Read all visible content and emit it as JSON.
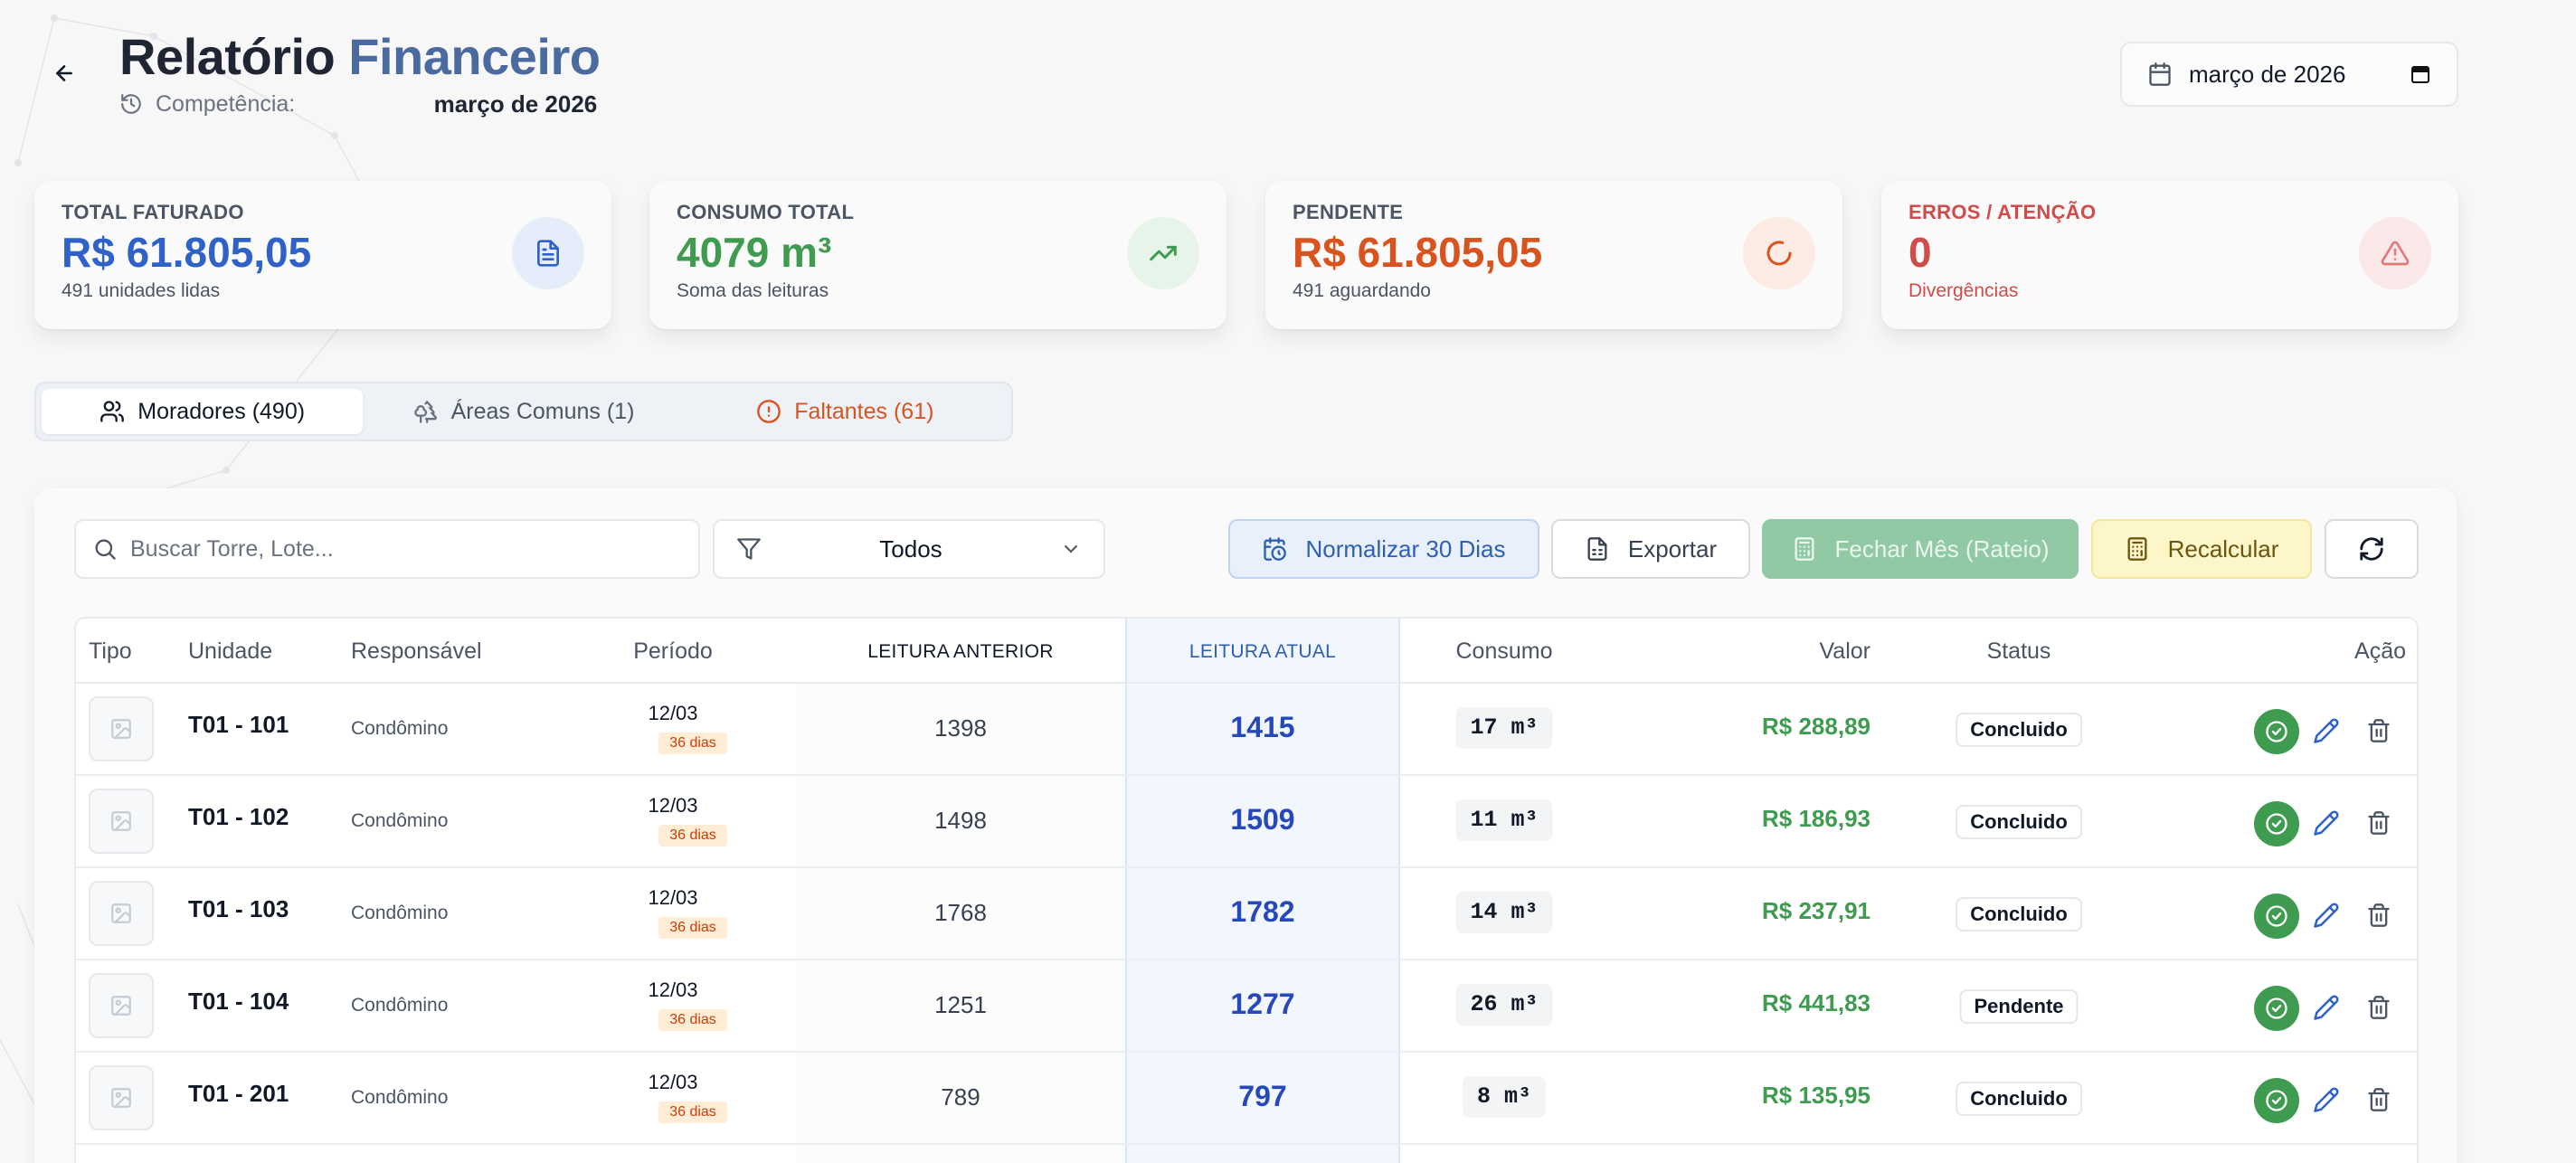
{
  "header": {
    "title_main": "Relatório",
    "title_accent": "Financeiro",
    "competencia_label": "Competência:",
    "competencia_value": "março de 2026",
    "month_picker_value": "março de 2026"
  },
  "stats": [
    {
      "label": "TOTAL FATURADO",
      "value": "R$ 61.805,05",
      "sub": "491 unidades lidas",
      "color": "#2f62c9",
      "icon": "document-icon"
    },
    {
      "label": "CONSUMO TOTAL",
      "value": "4079 m³",
      "sub": "Soma das leituras",
      "color": "#3f9b50",
      "icon": "trending-up-icon"
    },
    {
      "label": "PENDENTE",
      "value": "R$ 61.805,05",
      "sub": "491 aguardando",
      "color": "#d9531e",
      "icon": "spinner-icon"
    },
    {
      "label": "ERROS / ATENÇÃO",
      "value": "0",
      "sub": "Divergências",
      "color": "#d14b4b",
      "icon": "warning-icon"
    }
  ],
  "tabs": [
    {
      "label": "Moradores (490)",
      "icon": "users-icon",
      "active": true
    },
    {
      "label": "Áreas Comuns (1)",
      "icon": "trees-icon",
      "active": false
    },
    {
      "label": "Faltantes (61)",
      "icon": "alert-circle-icon",
      "active": false
    }
  ],
  "toolbar": {
    "search_placeholder": "Buscar Torre, Lote...",
    "filter_value": "Todos",
    "normalize_label": "Normalizar 30 Dias",
    "export_label": "Exportar",
    "close_month_label": "Fechar Mês (Rateio)",
    "recalc_label": "Recalcular"
  },
  "table": {
    "headers": {
      "tipo": "Tipo",
      "unidade": "Unidade",
      "responsavel": "Responsável",
      "periodo": "Período",
      "leitura_anterior": "LEITURA ANTERIOR",
      "leitura_atual": "LEITURA ATUAL",
      "consumo": "Consumo",
      "valor": "Valor",
      "status": "Status",
      "acao": "Ação"
    },
    "rows": [
      {
        "unidade": "T01 - 101",
        "responsavel": "Condômino",
        "data": "12/03",
        "dias": "36 dias",
        "anterior": "1398",
        "atual": "1415",
        "consumo": "17 m³",
        "valor": "R$ 288,89",
        "status": "Concluido"
      },
      {
        "unidade": "T01 - 102",
        "responsavel": "Condômino",
        "data": "12/03",
        "dias": "36 dias",
        "anterior": "1498",
        "atual": "1509",
        "consumo": "11 m³",
        "valor": "R$ 186,93",
        "status": "Concluido"
      },
      {
        "unidade": "T01 - 103",
        "responsavel": "Condômino",
        "data": "12/03",
        "dias": "36 dias",
        "anterior": "1768",
        "atual": "1782",
        "consumo": "14 m³",
        "valor": "R$ 237,91",
        "status": "Concluido"
      },
      {
        "unidade": "T01 - 104",
        "responsavel": "Condômino",
        "data": "12/03",
        "dias": "36 dias",
        "anterior": "1251",
        "atual": "1277",
        "consumo": "26 m³",
        "valor": "R$ 441,83",
        "status": "Pendente"
      },
      {
        "unidade": "T01 - 201",
        "responsavel": "Condômino",
        "data": "12/03",
        "dias": "36 dias",
        "anterior": "789",
        "atual": "797",
        "consumo": "8 m³",
        "valor": "R$ 135,95",
        "status": "Concluido"
      }
    ]
  }
}
